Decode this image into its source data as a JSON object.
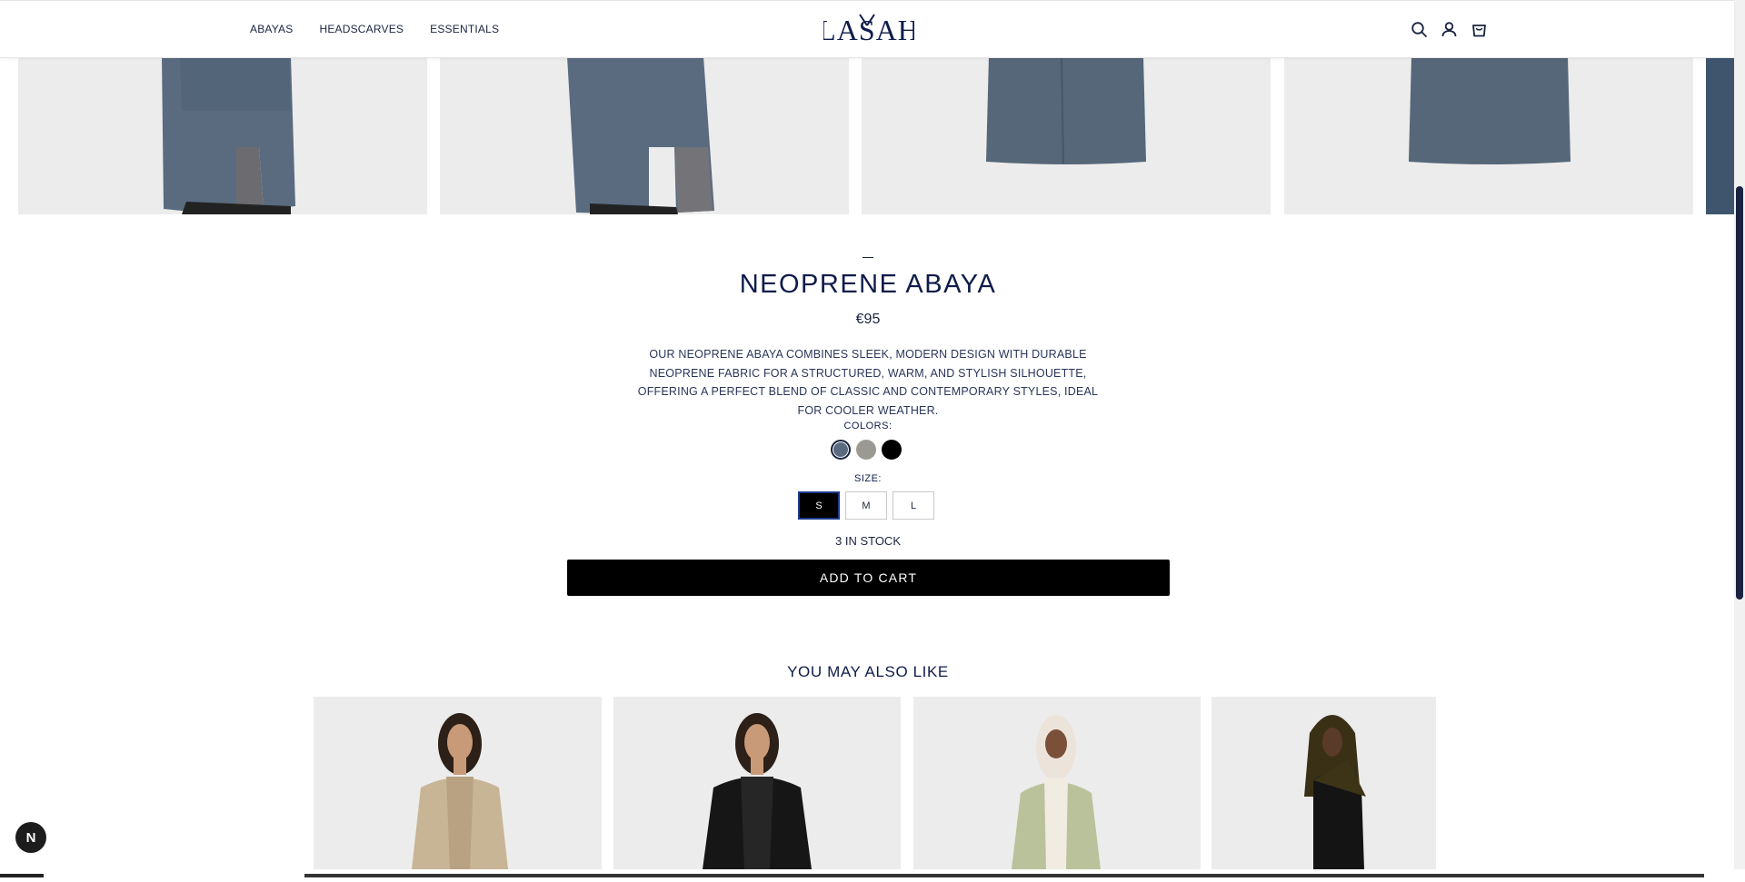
{
  "header": {
    "nav": [
      "ABAYAS",
      "HEADSCARVES",
      "ESSENTIALS"
    ],
    "logo": "LASAH",
    "icons": [
      "search-icon",
      "user-icon",
      "cart-icon"
    ]
  },
  "product": {
    "title": "NEOPRENE ABAYA",
    "price": "€95",
    "description": "OUR NEOPRENE ABAYA COMBINES SLEEK, MODERN DESIGN WITH DURABLE NEOPRENE FABRIC FOR A STRUCTURED, WARM, AND STYLISH SILHOUETTE, OFFERING A PERFECT BLEND OF CLASSIC AND CONTEMPORARY STYLES, IDEAL FOR COOLER WEATHER.",
    "colors_label": "COLORS:",
    "colors": [
      "#5a6b80",
      "#9a9a92",
      "#000000"
    ],
    "selected_color": 0,
    "size_label": "SIZE:",
    "sizes": [
      "S",
      "M",
      "L"
    ],
    "selected_size": "S",
    "stock": "3 IN STOCK",
    "add_to_cart": "ADD TO CART"
  },
  "recommendations": {
    "heading": "YOU MAY ALSO LIKE"
  },
  "badge": "N",
  "colors": {
    "abaya_blue": "#5a6b80",
    "image_bg": "#ececec",
    "navy": "#0f1c4a"
  }
}
